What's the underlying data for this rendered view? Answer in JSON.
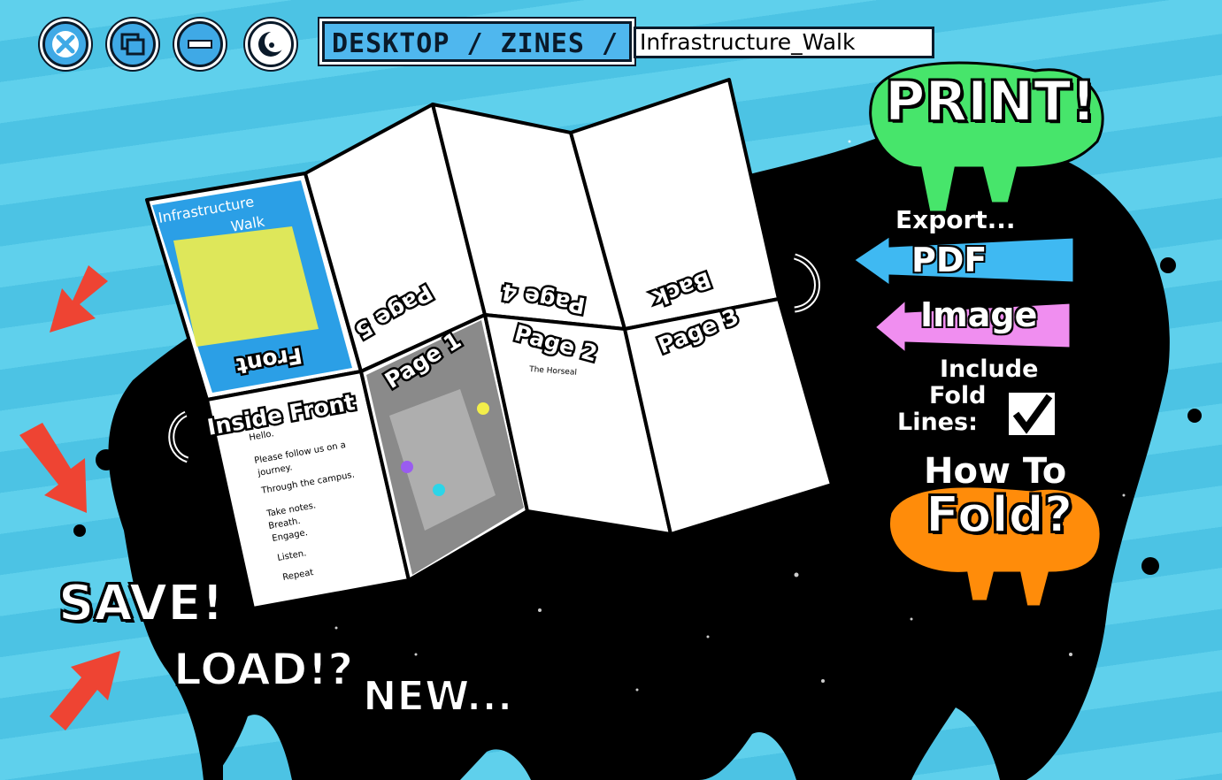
{
  "window": {
    "breadcrumb": "DESKTOP / ZINES /",
    "filename": "Infrastructure_Walk"
  },
  "toolbar": {
    "close_icon": "close-icon",
    "windows_icon": "windows-icon",
    "minimize_icon": "minimize-icon",
    "theme_icon": "moon-sun-icon"
  },
  "zine": {
    "pages": {
      "front": "Front",
      "page5": "Page 5",
      "page4": "Page 4",
      "back": "Back",
      "inside_front": "Inside Front",
      "page1": "Page 1",
      "page2": "Page 2",
      "page3": "Page 3"
    },
    "cover_title": "Infrastructure\nWalk",
    "inside_front_text": [
      "Hello.",
      "Please follow us on a",
      "journey.",
      "Through the campus.",
      "Take notes.",
      "Breath.",
      "Engage.",
      "Listen.",
      "Repeat"
    ],
    "page2_text": [
      "The Horseal"
    ]
  },
  "menu": {
    "print_label": "PRINT!",
    "export_label": "Export...",
    "pdf_label": "PDF",
    "image_label": "Image",
    "fold_lines_label_1": "Include",
    "fold_lines_label_2": "Fold",
    "fold_lines_label_3": "Lines:",
    "fold_lines_checked": true,
    "how_to_label_1": "How To",
    "how_to_label_2": "Fold?"
  },
  "file_actions": {
    "save_label": "SAVE!",
    "load_label": "LOAD!?",
    "new_label": "NEW..."
  },
  "colors": {
    "background": "#5fd0ec",
    "ink": "#000000",
    "print_blob": "#47e56b",
    "pdf_arrow": "#3fb9f2",
    "image_arrow": "#f08ef0",
    "how_to_blob": "#ff8c0a",
    "arrow_red": "#ee4433"
  }
}
